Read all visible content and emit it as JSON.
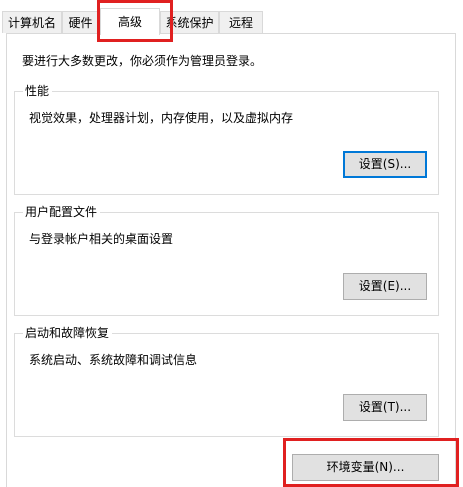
{
  "tabs": [
    {
      "label": "计算机名",
      "active": false
    },
    {
      "label": "硬件",
      "active": false
    },
    {
      "label": "高级",
      "active": true
    },
    {
      "label": "系统保护",
      "active": false
    },
    {
      "label": "远程",
      "active": false
    }
  ],
  "admin_note": "要进行大多数更改，你必须作为管理员登录。",
  "performance": {
    "title": "性能",
    "description": "视觉效果，处理器计划，内存使用，以及虚拟内存",
    "button_label": "设置(S)..."
  },
  "user_profiles": {
    "title": "用户配置文件",
    "description": "与登录帐户相关的桌面设置",
    "button_label": "设置(E)..."
  },
  "startup_recovery": {
    "title": "启动和故障恢复",
    "description": "系统启动、系统故障和调试信息",
    "button_label": "设置(T)..."
  },
  "env_vars": {
    "button_label": "环境变量(N)..."
  },
  "colors": {
    "highlight": "#e02020",
    "focus": "#0078d7",
    "button_bg": "#e1e1e1",
    "tab_bg": "#f0f0f0"
  }
}
